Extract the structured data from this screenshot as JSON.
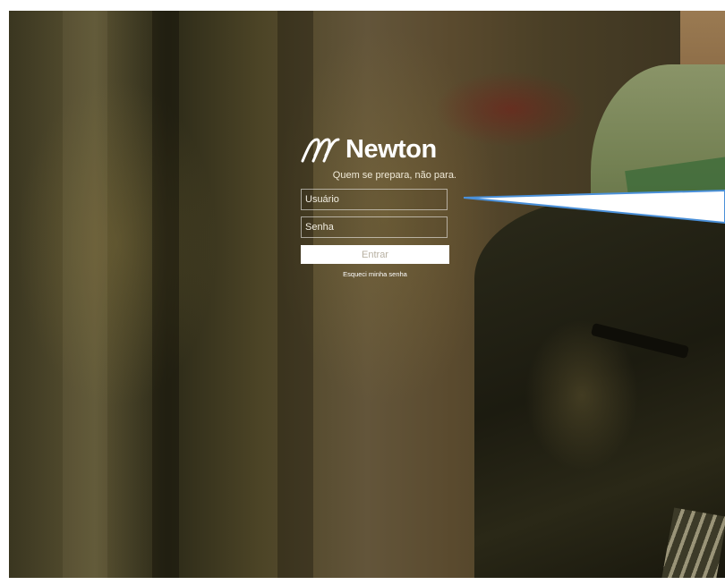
{
  "brand": {
    "name": "Newton",
    "tagline": "Quem se prepara, não para.",
    "logo_icon": "newton-logo-icon"
  },
  "login": {
    "username_placeholder": "Usuário",
    "username_value": "",
    "password_placeholder": "Senha",
    "password_value": "",
    "submit_label": "Entrar",
    "forgot_password_label": "Esqueci minha senha"
  },
  "colors": {
    "text": "#ffffff",
    "button_background": "#ffffff",
    "button_text": "#b8b1a2",
    "callout_outline": "#4a90d9"
  }
}
